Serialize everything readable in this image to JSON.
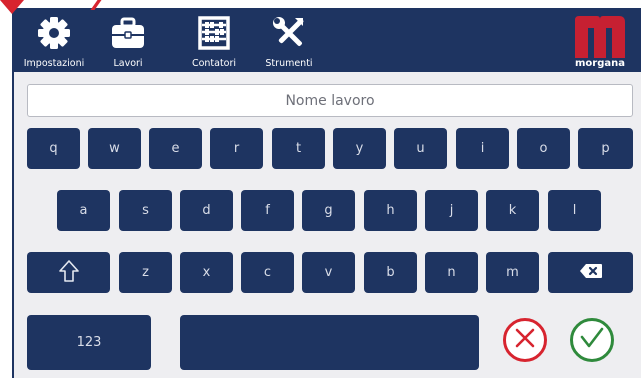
{
  "colors": {
    "navy": "#1e3461",
    "background": "#eeeef1",
    "accent_red": "#d7242f",
    "confirm_green": "#2f8a3c"
  },
  "toolbar": {
    "items": [
      {
        "label": "Impostazioni",
        "icon": "gear-icon"
      },
      {
        "label": "Lavori",
        "icon": "briefcase-icon"
      },
      {
        "label": "Contatori",
        "icon": "abacus-icon"
      },
      {
        "label": "Strumenti",
        "icon": "tools-icon"
      }
    ],
    "logo_text": "morgana"
  },
  "job_name": {
    "value": "",
    "placeholder": "Nome lavoro"
  },
  "keyboard": {
    "row1": [
      "q",
      "w",
      "e",
      "r",
      "t",
      "y",
      "u",
      "i",
      "o",
      "p"
    ],
    "row2": [
      "a",
      "s",
      "d",
      "f",
      "g",
      "h",
      "j",
      "k",
      "l"
    ],
    "row3": [
      "z",
      "x",
      "c",
      "v",
      "b",
      "n",
      "m"
    ],
    "shift_icon": "shift-arrow-icon",
    "backspace_icon": "backspace-icon",
    "numbers_label": "123",
    "cancel_icon": "cancel-x-icon",
    "confirm_icon": "confirm-check-icon"
  }
}
